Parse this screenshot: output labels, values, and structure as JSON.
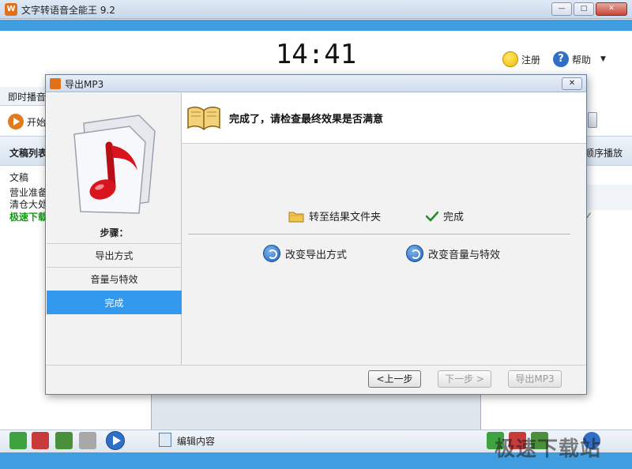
{
  "window": {
    "title": "文字转语音全能王 9.2",
    "min_label": "—",
    "max_label": "□",
    "close_label": "✕"
  },
  "header": {
    "clock": "14:41",
    "register_label": "注册",
    "help_label": "帮助",
    "dropdown_glyph": "▼"
  },
  "left_panel": {
    "tab_label": "即时播音",
    "start_label": "开始",
    "list_header": "文稿列表",
    "lines": [
      "文稿",
      "营业准备",
      "清仓大处",
      "极速下载"
    ]
  },
  "right_panel": {
    "header_label": "顺序播放",
    "check_glyph": "✓"
  },
  "bottom_toolbar": {
    "edit_label": "编辑内容"
  },
  "watermark": "极速下载站",
  "dialog": {
    "title": "导出MP3",
    "close_label": "✕",
    "heading": "完成了，请检查最终效果是否满意",
    "steps_title": "步骤：",
    "steps": [
      "导出方式",
      "音量与特效",
      "完成"
    ],
    "active_step": 2,
    "open_folder_label": "转至结果文件夹",
    "done_label": "完成",
    "change_export_label": "改变导出方式",
    "change_volume_label": "改变音量与特效",
    "prev_label": "<上一步",
    "next_label": "下一步 >",
    "export_label": "导出MP3"
  },
  "colors": {
    "accent_blue": "#3f9de0",
    "active_step": "#3399ee",
    "note_red": "#d8141e",
    "green_text": "#149a14"
  }
}
